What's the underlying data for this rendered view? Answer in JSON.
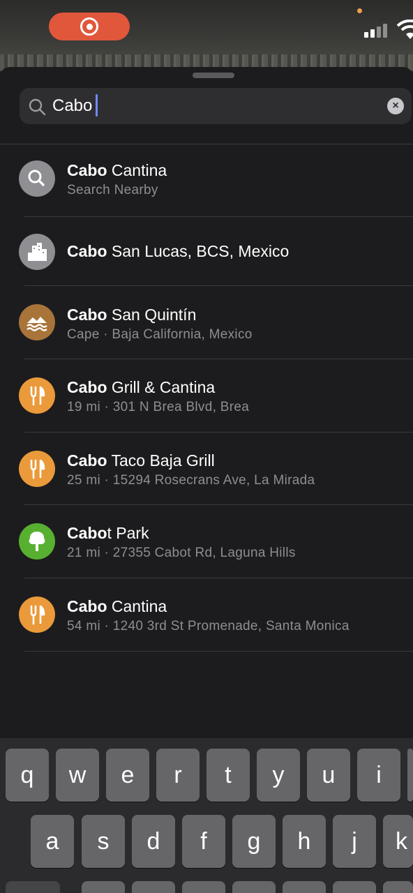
{
  "status_bar": {
    "recording_indicator": "record-icon"
  },
  "search": {
    "value": "Cabo",
    "clear_icon": "×"
  },
  "results": [
    {
      "icon": "magnifier",
      "color": "#8e8e93",
      "bold": "Cabo",
      "rest": " Cantina",
      "subtitle": "Search Nearby"
    },
    {
      "icon": "city",
      "color": "#8e8e93",
      "bold": "Cabo",
      "rest": " San Lucas, BCS, Mexico",
      "subtitle": ""
    },
    {
      "icon": "cape",
      "color": "#a8743a",
      "bold": "Cabo",
      "rest": " San Quintín",
      "subtitle": "Cape · Baja California, Mexico"
    },
    {
      "icon": "fork-knife",
      "color": "#ea9a3a",
      "bold": "Cabo",
      "rest": " Grill & Cantina",
      "subtitle": "19 mi · 301 N Brea Blvd, Brea"
    },
    {
      "icon": "fork-knife",
      "color": "#ea9a3a",
      "bold": "Cabo",
      "rest": " Taco Baja Grill",
      "subtitle": "25 mi · 15294 Rosecrans Ave, La Mirada"
    },
    {
      "icon": "tree",
      "color": "#58b031",
      "bold": "Cabo",
      "rest": "t Park",
      "subtitle": "21 mi · 27355 Cabot Rd, Laguna Hills"
    },
    {
      "icon": "fork-knife",
      "color": "#ea9a3a",
      "bold": "Cabo",
      "rest": " Cantina",
      "subtitle": "54 mi · 1240 3rd St Promenade, Santa Monica"
    }
  ],
  "keyboard": {
    "row1": [
      "q",
      "w",
      "e",
      "r",
      "t",
      "y",
      "u",
      "i"
    ],
    "row2": [
      "a",
      "s",
      "d",
      "f",
      "g",
      "h",
      "j",
      "k"
    ]
  }
}
